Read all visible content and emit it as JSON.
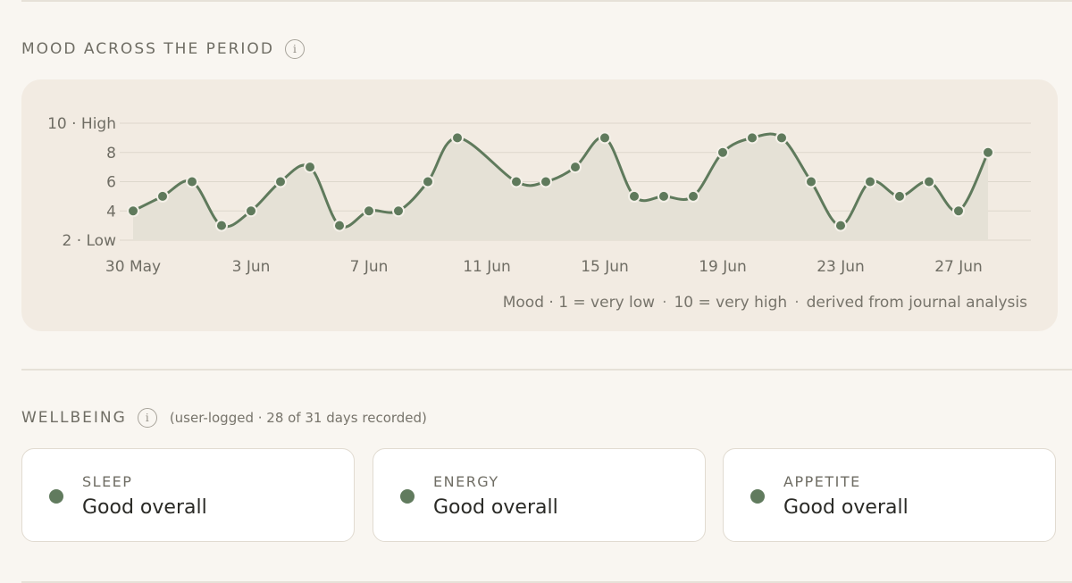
{
  "mood_section": {
    "title": "MOOD ACROSS THE PERIOD",
    "info_icon": "info-icon",
    "caption_parts": [
      "Mood · 1 = very low",
      "10 = very high",
      "derived from journal analysis"
    ],
    "caption_separator": "·"
  },
  "chart_data": {
    "type": "line",
    "x": [
      "30 May",
      "31 May",
      "1 Jun",
      "2 Jun",
      "3 Jun",
      "4 Jun",
      "5 Jun",
      "6 Jun",
      "7 Jun",
      "8 Jun",
      "9 Jun",
      "10 Jun",
      "11 Jun",
      "12 Jun",
      "13 Jun",
      "14 Jun",
      "15 Jun",
      "16 Jun",
      "17 Jun",
      "18 Jun",
      "19 Jun",
      "20 Jun",
      "21 Jun",
      "22 Jun",
      "23 Jun",
      "24 Jun",
      "25 Jun",
      "26 Jun",
      "27 Jun",
      "28 Jun"
    ],
    "values": [
      4,
      5,
      6,
      3,
      4,
      6,
      7,
      3,
      4,
      4,
      6,
      9,
      null,
      6,
      6,
      7,
      9,
      5,
      5,
      5,
      8,
      9,
      9,
      6,
      3,
      6,
      5,
      6,
      4,
      8
    ],
    "x_tick_labels": [
      "30 May",
      "3 Jun",
      "7 Jun",
      "11 Jun",
      "15 Jun",
      "19 Jun",
      "23 Jun",
      "27 Jun"
    ],
    "y_tick_labels": [
      "10 · High",
      "8",
      "6",
      "4",
      "2 · Low"
    ],
    "y_ticks": [
      10,
      8,
      6,
      4,
      2
    ],
    "ylim": [
      2,
      10
    ],
    "grid": true,
    "area_fill": true,
    "line_color": "#5f7a5c",
    "fill_color": "#e5e1d6"
  },
  "wellbeing": {
    "title": "WELLBEING",
    "info_icon": "info-icon",
    "note": "(user-logged · 28 of 31 days recorded)",
    "cards": [
      {
        "label": "SLEEP",
        "value": "Good overall",
        "dot_color": "#617b5e"
      },
      {
        "label": "ENERGY",
        "value": "Good overall",
        "dot_color": "#617b5e"
      },
      {
        "label": "APPETITE",
        "value": "Good overall",
        "dot_color": "#617b5e"
      }
    ]
  }
}
